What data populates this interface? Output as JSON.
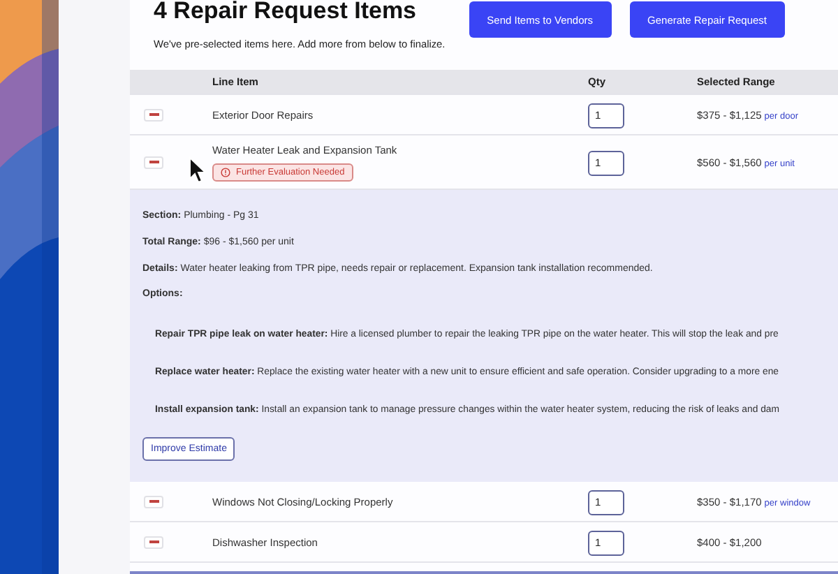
{
  "header": {
    "title": "4 Repair Request Items",
    "subtitle": "We've pre-selected items here. Add more from below to finalize.",
    "actions": [
      "Send Items to Vendors",
      "Generate Repair Request"
    ]
  },
  "table": {
    "columns": [
      "Line Item",
      "Qty",
      "Selected Range"
    ],
    "rows": [
      {
        "name": "Exterior Door Repairs",
        "qty": "1",
        "range": "$375 - $1,125",
        "unit": "per door"
      },
      {
        "name": "Water Heater Leak and Expansion Tank",
        "badge": "Further Evaluation Needed",
        "qty": "1",
        "range": "$560 - $1,560",
        "unit": "per unit",
        "details": {
          "lines": [
            "**Section:** Plumbing - Pg 31",
            "**Total Range:** $96 - $1,560  per unit",
            "**Details:** Water heater leaking from TPR pipe, needs repair or replacement. Expansion tank installation recommended."
          ],
          "options_label": "Options:",
          "options": [
            "**Repair TPR pipe leak on water heater:** Hire a licensed plumber to repair the leaking TPR pipe on the water heater. This will stop the leak and pre",
            "**Replace water heater:** Replace the existing water heater with a new unit to ensure efficient and safe operation. Consider upgrading to a more ene",
            "**Install expansion tank:** Install an expansion tank to manage pressure changes within the water heater system, reducing the risk of leaks and dam"
          ],
          "button": "Improve Estimate"
        }
      },
      {
        "name": "Windows Not Closing/Locking Properly",
        "qty": "1",
        "range": "$350 - $1,170",
        "unit": "per window"
      },
      {
        "name": "Dishwasher Inspection",
        "qty": "1",
        "range": "$400 - $1,200"
      }
    ]
  }
}
